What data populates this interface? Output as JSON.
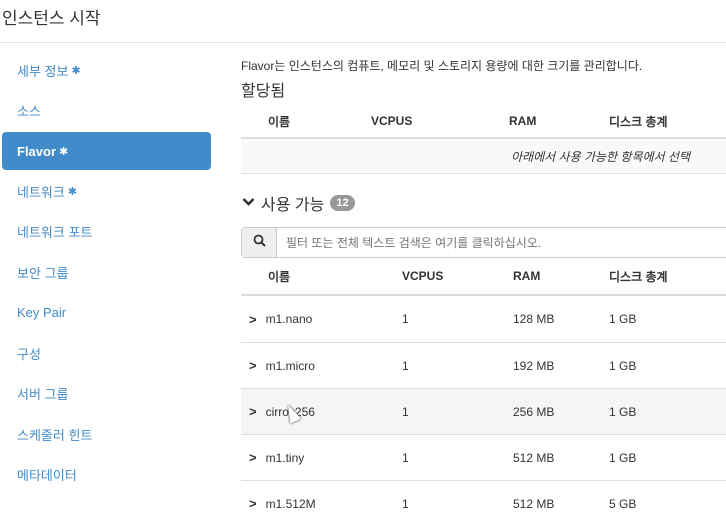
{
  "title": "인스턴스 시작",
  "sidebar": {
    "items": [
      {
        "label": "세부 정보",
        "required": true
      },
      {
        "label": "소스",
        "required": false
      },
      {
        "label": "Flavor",
        "required": true,
        "active": true
      },
      {
        "label": "네트워크",
        "required": true
      },
      {
        "label": "네트워크 포트",
        "required": false
      },
      {
        "label": "보안 그룹",
        "required": false
      },
      {
        "label": "Key Pair",
        "required": false
      },
      {
        "label": "구성",
        "required": false
      },
      {
        "label": "서버 그룹",
        "required": false
      },
      {
        "label": "스케줄러 힌트",
        "required": false
      },
      {
        "label": "메타데이터",
        "required": false
      }
    ],
    "star": "✱"
  },
  "main": {
    "help": "Flavor는 인스턴스의 컴퓨트, 메모리 및 스토리지 용량에 대한 크기를 관리합니다.",
    "allocated": {
      "title": "할당됨",
      "empty": "아래에서 사용 가능한 항목에서 선택"
    },
    "columns": [
      "이름",
      "VCPUS",
      "RAM",
      "디스크 총계"
    ],
    "available": {
      "title": "사용 가능",
      "count": "12"
    },
    "search": {
      "placeholder": "필터 또는 전체 텍스트 검색은 여기를 클릭하십시오."
    },
    "rows": [
      {
        "name": "m1.nano",
        "vcpus": "1",
        "ram": "128 MB",
        "disk": "1 GB"
      },
      {
        "name": "m1.micro",
        "vcpus": "1",
        "ram": "192 MB",
        "disk": "1 GB"
      },
      {
        "name": "cirros256",
        "vcpus": "1",
        "ram": "256 MB",
        "disk": "1 GB"
      },
      {
        "name": "m1.tiny",
        "vcpus": "1",
        "ram": "512 MB",
        "disk": "1 GB"
      },
      {
        "name": "m1.512M",
        "vcpus": "1",
        "ram": "512 MB",
        "disk": "5 GB"
      }
    ]
  }
}
